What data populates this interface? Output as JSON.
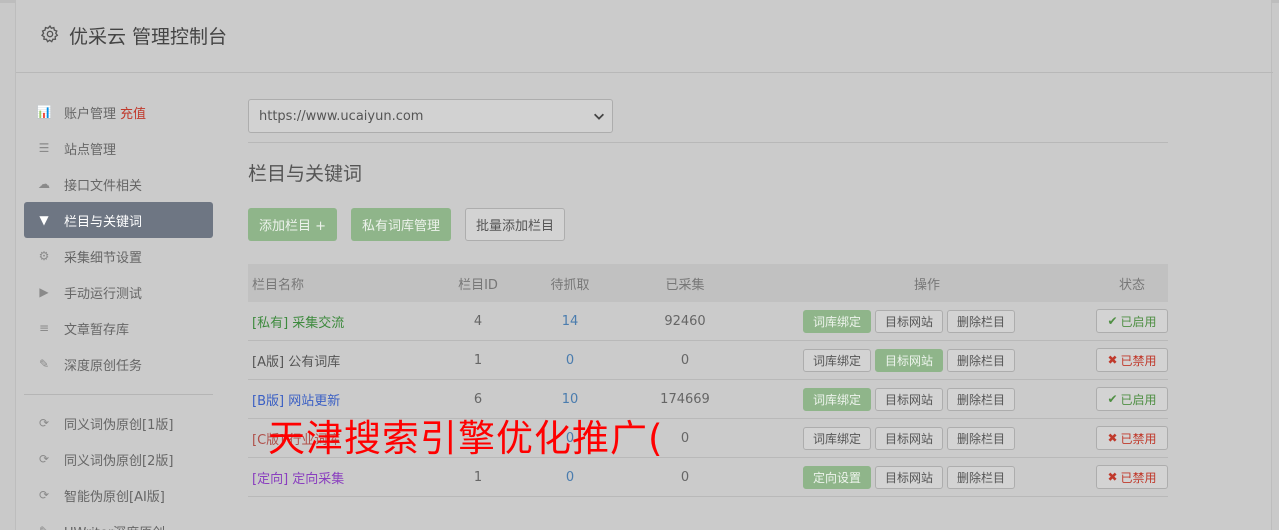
{
  "header": {
    "title": "优采云 管理控制台"
  },
  "sidebar": {
    "items": [
      {
        "label": "账户管理",
        "extra": "充值",
        "icon": "bar-chart-icon",
        "glyph": "📊"
      },
      {
        "label": "站点管理",
        "icon": "server-icon",
        "glyph": "☰"
      },
      {
        "label": "接口文件相关",
        "icon": "cloud-upload-icon",
        "glyph": "☁"
      },
      {
        "label": "栏目与关键词",
        "icon": "filter-icon",
        "glyph": "▼",
        "active": true
      },
      {
        "label": "采集细节设置",
        "icon": "cogs-icon",
        "glyph": "⚙"
      },
      {
        "label": "手动运行测试",
        "icon": "play-circle-icon",
        "glyph": "▶"
      },
      {
        "label": "文章暂存库",
        "icon": "database-icon",
        "glyph": "≡"
      },
      {
        "label": "深度原创任务",
        "icon": "edit-icon",
        "glyph": "✎"
      }
    ],
    "items2": [
      {
        "label": "同义词伪原创[1版]",
        "icon": "refresh-icon",
        "glyph": "⟳"
      },
      {
        "label": "同义词伪原创[2版]",
        "icon": "refresh-icon",
        "glyph": "⟳"
      },
      {
        "label": "智能伪原创[AI版]",
        "icon": "refresh-icon",
        "glyph": "⟳"
      },
      {
        "label": "UWriter深度原创",
        "icon": "edit-icon",
        "glyph": "✎"
      }
    ]
  },
  "site_select": {
    "value": "https://www.ucaiyun.com"
  },
  "section_title": "栏目与关键词",
  "buttons": {
    "add_column": "添加栏目 +",
    "private_lib": "私有词库管理",
    "batch_add": "批量添加栏目"
  },
  "table": {
    "headers": [
      "栏目名称",
      "栏目ID",
      "待抓取",
      "已采集",
      "操作",
      "状态"
    ],
    "rows": [
      {
        "tag": "[私有]",
        "name": "采集交流",
        "tag_color": "#3d8a3d",
        "name_color": "#3d8a3d",
        "id": "4",
        "pending": "14",
        "collected": "92460",
        "first_action": "词库绑定",
        "first_green": true,
        "target_green": false,
        "status": "已启用",
        "status_on": true
      },
      {
        "tag": "[A版]",
        "name": "公有词库",
        "tag_color": "#555555",
        "name_color": "#555555",
        "id": "1",
        "pending": "0",
        "collected": "0",
        "first_action": "词库绑定",
        "first_green": false,
        "target_green": true,
        "status": "已禁用",
        "status_on": false
      },
      {
        "tag": "[B版]",
        "name": "网站更新",
        "tag_color": "#3a5fc4",
        "name_color": "#3a5fc4",
        "id": "6",
        "pending": "10",
        "collected": "174669",
        "first_action": "词库绑定",
        "first_green": true,
        "target_green": false,
        "status": "已启用",
        "status_on": true
      },
      {
        "tag": "[C版]",
        "name": "行业词库",
        "tag_color": "#b0504a",
        "name_color": "#b0504a",
        "id": "",
        "pending": "0",
        "collected": "0",
        "first_action": "词库绑定",
        "first_green": false,
        "target_green": false,
        "status": "已禁用",
        "status_on": false
      },
      {
        "tag": "[定向]",
        "name": "定向采集",
        "tag_color": "#8a3fbf",
        "name_color": "#8a3fbf",
        "id": "1",
        "pending": "0",
        "collected": "0",
        "first_action": "定向设置",
        "first_green": true,
        "target_green": false,
        "status": "已禁用",
        "status_on": false
      }
    ],
    "target_label": "目标网站",
    "delete_label": "删除栏目"
  },
  "overlay": {
    "watermark": "天津搜索引擎优化推广("
  }
}
